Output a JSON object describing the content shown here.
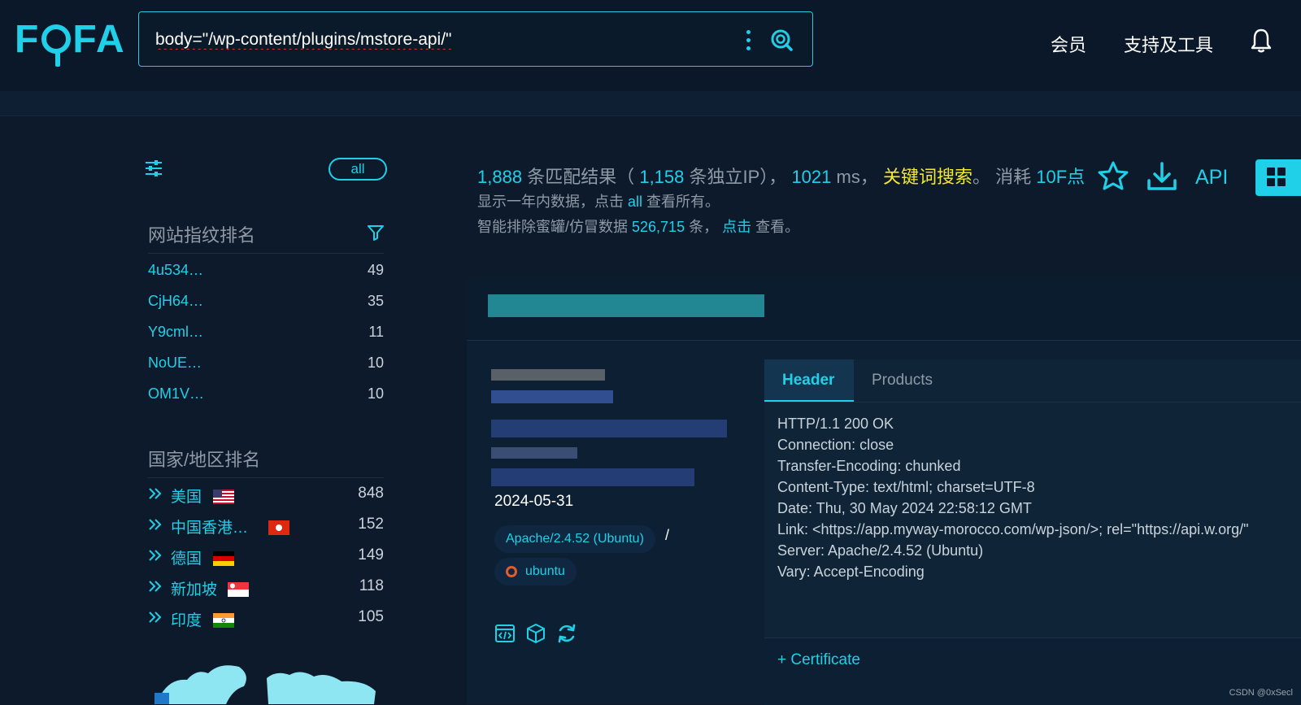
{
  "header": {
    "logo_text": [
      "F",
      "FA"
    ],
    "search": {
      "value": "body=\"/wp-content/plugins/mstore-api/\""
    },
    "nav": {
      "member": "会员",
      "tools": "支持及工具"
    }
  },
  "sidebar": {
    "all_label": "all",
    "fingerprint_title": "网站指纹排名",
    "fingerprints": [
      {
        "label": "4u534…",
        "count": "49"
      },
      {
        "label": "CjH64…",
        "count": "35"
      },
      {
        "label": "Y9cml…",
        "count": "11"
      },
      {
        "label": "NoUE…",
        "count": "10"
      },
      {
        "label": "OM1V…",
        "count": "10"
      }
    ],
    "country_title": "国家/地区排名",
    "countries": [
      {
        "label": "美国",
        "count": "848",
        "flag": "us-flag"
      },
      {
        "label": "中国香港…",
        "count": "152",
        "flag": "hk-flag"
      },
      {
        "label": "德国",
        "count": "149",
        "flag": "de-flag"
      },
      {
        "label": "新加坡",
        "count": "118",
        "flag": "sg-flag"
      },
      {
        "label": "印度",
        "count": "105",
        "flag": "in-flag"
      }
    ]
  },
  "results": {
    "match_count": "1,888",
    "match_label": "条匹配结果（",
    "ip_count": "1,158",
    "ip_label": "条独立IP），",
    "time_value": "1021",
    "time_unit": "ms，",
    "keyword_search": "关键词搜索",
    "period": "。",
    "cost_label": "消耗",
    "cost_value": "10F点",
    "line2_pre": "显示一年内数据，点击",
    "line2_all": "all",
    "line2_post": "查看所有。",
    "line3_pre": "智能排除蜜罐/仿冒数据",
    "line3_num": "526,715",
    "line3_mid": "条，",
    "line3_click": "点击",
    "line3_post": "查看。",
    "api_label": "API"
  },
  "card": {
    "date": "2024-05-31",
    "server_tag": "Apache/2.4.52 (Ubuntu)",
    "slash": "/",
    "os_tag": "ubuntu",
    "tabs": {
      "header": "Header",
      "products": "Products"
    },
    "header_lines": [
      "HTTP/1.1 200 OK",
      "Connection: close",
      "Transfer-Encoding: chunked",
      "Content-Type: text/html; charset=UTF-8",
      "Date: Thu, 30 May 2024 22:58:12 GMT",
      "Link: <https://app.myway-morocco.com/wp-json/>; rel=\"https://api.w.org/\"",
      "Server: Apache/2.4.52 (Ubuntu)",
      "Vary: Accept-Encoding"
    ],
    "certificate": "Certificate"
  },
  "watermark": "CSDN @0xSecl",
  "colors": {
    "accent": "#1fd0e8",
    "keyword": "#f5e92a",
    "background": "#0c1a2b"
  }
}
